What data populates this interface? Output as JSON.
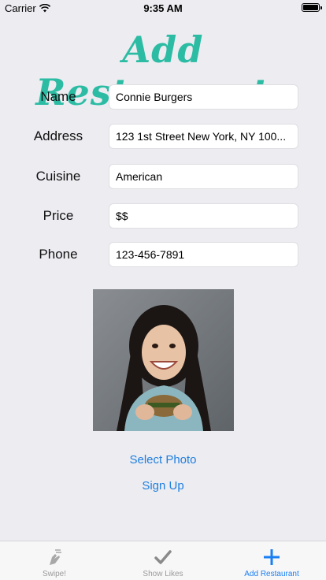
{
  "status_bar": {
    "carrier": "Carrier",
    "time": "9:35 AM"
  },
  "title": "Add Restaurants",
  "form": [
    {
      "label": "Name",
      "value": "Connie Burgers"
    },
    {
      "label": "Address",
      "value": "123 1st Street New York, NY 100..."
    },
    {
      "label": "Cuisine",
      "value": "American"
    },
    {
      "label": "Price",
      "value": "$$"
    },
    {
      "label": "Phone",
      "value": "123-456-7891"
    }
  ],
  "actions": {
    "select_photo": "Select Photo",
    "sign_up": "Sign Up"
  },
  "tabs": [
    {
      "label": "Swipe!",
      "icon": "swipe-hand-icon",
      "active": false
    },
    {
      "label": "Show Likes",
      "icon": "checkmark-icon",
      "active": false
    },
    {
      "label": "Add Restaurant",
      "icon": "plus-icon",
      "active": true
    }
  ],
  "colors": {
    "title": "#2cbca4",
    "link": "#1f7fe0",
    "active_tab": "#1a7ff2",
    "background": "#ececf1"
  }
}
